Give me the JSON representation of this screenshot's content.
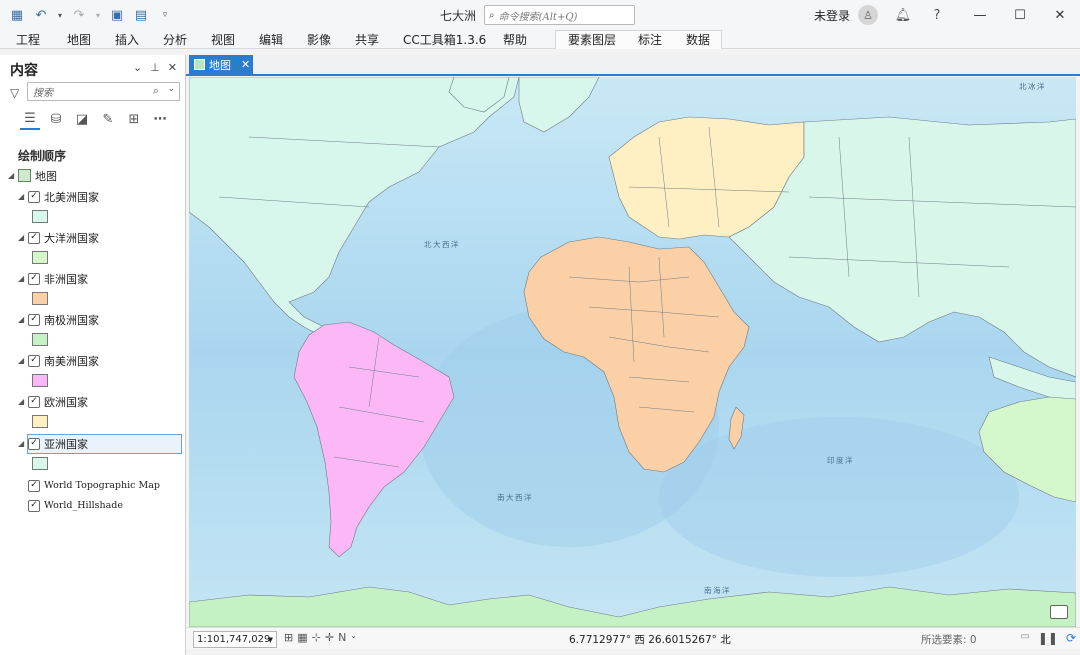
{
  "app": {
    "title": "七大洲",
    "search_placeholder": "命令搜索(Alt+Q)",
    "login": "未登录"
  },
  "ribbon_tabs": [
    "工程",
    "地图",
    "插入",
    "分析",
    "视图",
    "编辑",
    "影像",
    "共享",
    "CC工具箱1.3.6",
    "帮助",
    "要素图层",
    "标注",
    "数据"
  ],
  "contents": {
    "title": "内容",
    "search_placeholder": "搜索",
    "draw_order": "绘制顺序",
    "map_label": "地图",
    "layers": [
      {
        "name": "北美洲国家",
        "color": "#d7f6ec"
      },
      {
        "name": "大洋洲国家",
        "color": "#d4f7cc"
      },
      {
        "name": "非洲国家",
        "color": "#fbd0a6"
      },
      {
        "name": "南极洲国家",
        "color": "#c4f2c4"
      },
      {
        "name": "南美洲国家",
        "color": "#fcb8f6"
      },
      {
        "name": "欧洲国家",
        "color": "#fff0c3"
      },
      {
        "name": "亚洲国家",
        "color": "#d8f6e9"
      }
    ],
    "basemaps": [
      "World Topographic Map",
      "World_Hillshade"
    ]
  },
  "map": {
    "tab_label": "地图",
    "ocean_labels": [
      "北冰洋",
      "北大西洋",
      "南大西洋",
      "印度洋",
      "南海洋"
    ]
  },
  "status": {
    "scale": "1:101,747,029",
    "coords": "6.7712977° 西  26.6015267° 北",
    "selected": "所选要素: 0"
  }
}
